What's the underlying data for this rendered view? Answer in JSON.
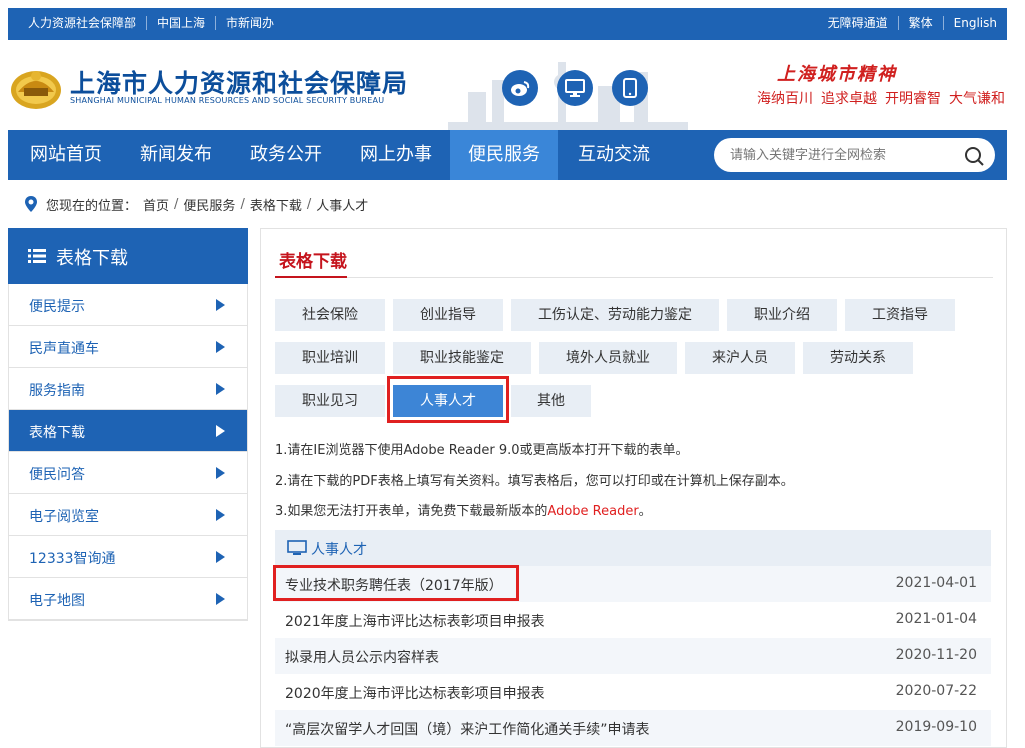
{
  "topbar": {
    "links": [
      "人力资源社会保障部",
      "中国上海",
      "市新闻办"
    ],
    "right_links": [
      "无障碍通道",
      "繁体",
      "English"
    ]
  },
  "header": {
    "org_name_cn": "上海市人力资源和社会保障局",
    "org_name_en": "SHANGHAI MUNICIPAL HUMAN RESOURCES AND SOCIAL SECURITY BUREAU",
    "spirit_title": "上海城市精神",
    "spirit_values": [
      "海纳百川",
      "追求卓越",
      "开明睿智",
      "大气谦和"
    ],
    "social_icons": [
      "weibo-icon",
      "desktop-icon",
      "mobile-icon"
    ]
  },
  "nav": {
    "items": [
      "网站首页",
      "新闻发布",
      "政务公开",
      "网上办事",
      "便民服务",
      "互动交流"
    ],
    "active": "便民服务",
    "search_placeholder": "请输入关键字进行全网检索"
  },
  "breadcrumb": {
    "prefix": "您现在的位置：",
    "items": [
      "首页",
      "便民服务",
      "表格下载",
      "人事人才"
    ]
  },
  "sidebar": {
    "title": "表格下载",
    "items": [
      "便民提示",
      "民声直通车",
      "服务指南",
      "表格下载",
      "便民问答",
      "电子阅览室",
      "12333智询通",
      "电子地图"
    ],
    "active": "表格下载"
  },
  "content": {
    "title": "表格下载",
    "categories": [
      "社会保险",
      "创业指导",
      "工伤认定、劳动能力鉴定",
      "职业介绍",
      "工资指导",
      "职业培训",
      "职业技能鉴定",
      "境外人员就业",
      "来沪人员",
      "劳动关系",
      "职业见习",
      "人事人才",
      "其他"
    ],
    "active_category": "人事人才",
    "notes": [
      "1.请在IE浏览器下使用Adobe Reader 9.0或更高版本打开下载的表单。",
      "2.请在下载的PDF表格上填写有关资料。填写表格后，您可以打印或在计算机上保存副本。",
      "3.如果您无法打开表单，请免费下载最新版本的"
    ],
    "note3_link": "Adobe Reader",
    "note3_suffix": "。",
    "list_title": "人事人才",
    "rows": [
      {
        "name": "专业技术职务聘任表（2017年版）",
        "date": "2021-04-01"
      },
      {
        "name": "2021年度上海市评比达标表彰项目申报表",
        "date": "2021-01-04"
      },
      {
        "name": "拟录用人员公示内容样表",
        "date": "2020-11-20"
      },
      {
        "name": "2020年度上海市评比达标表彰项目申报表",
        "date": "2020-07-22"
      },
      {
        "name": "“高层次留学人才回国（境）来沪工作简化通关手续”申请表",
        "date": "2019-09-10"
      }
    ]
  },
  "colors": {
    "brand_blue": "#1e63b4",
    "active_blue": "#3a86d8",
    "accent_red": "#c5141d",
    "highlight_red": "#e02020"
  }
}
